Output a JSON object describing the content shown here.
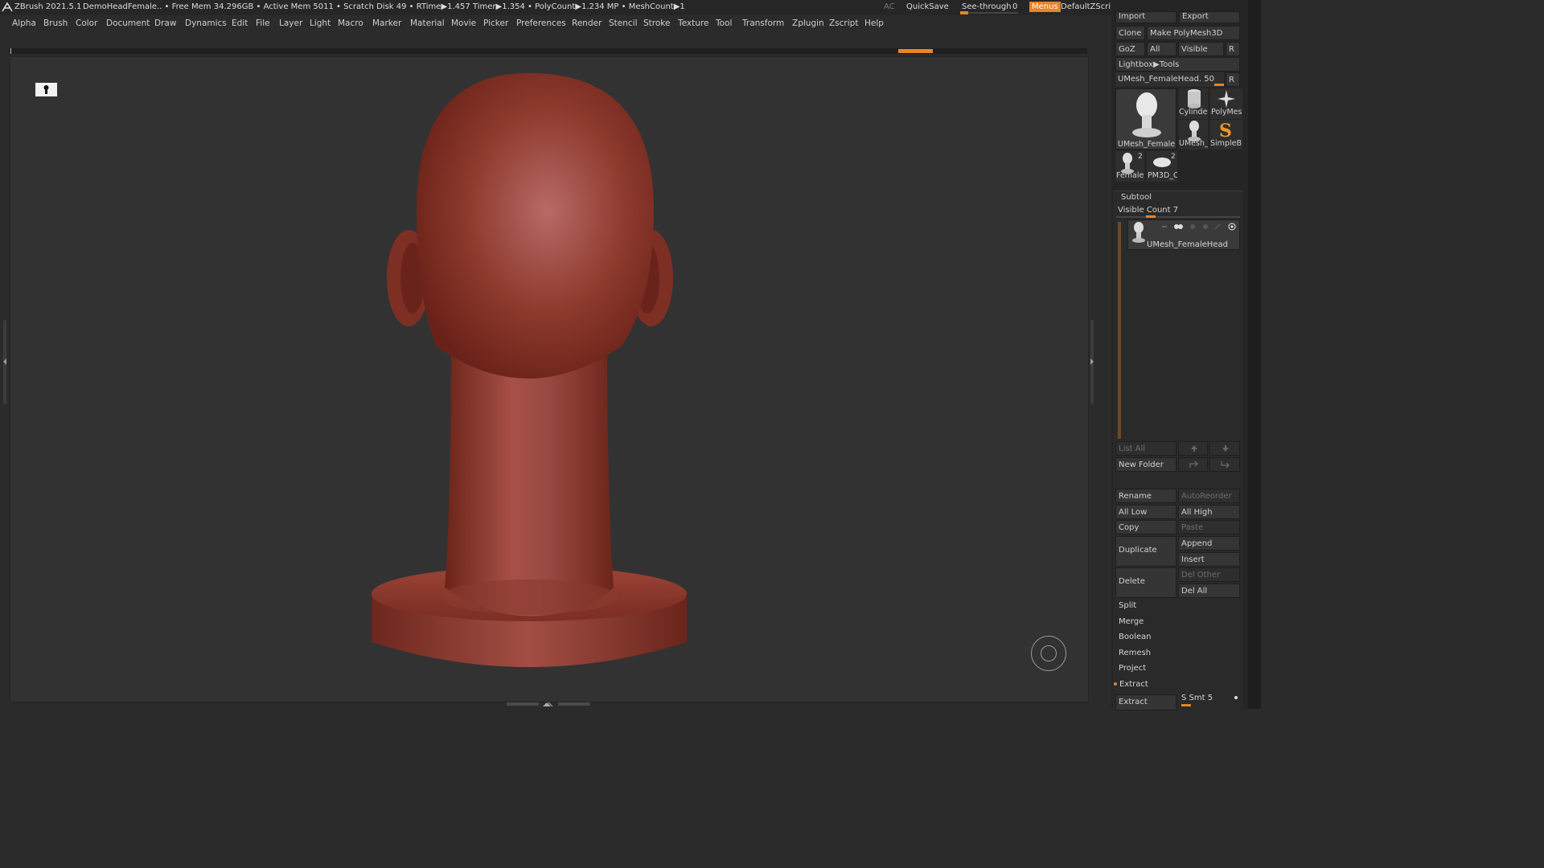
{
  "titlebar": {
    "app": "ZBrush 2021.5.1",
    "document": "DemoHeadFemale",
    "stats": ".. • Free Mem 34.296GB • Active Mem 5011 • Scratch Disk 49 •  RTime▶1.457 Timer▶1.354 • PolyCount▶1.234 MP  • MeshCount▶1",
    "ac": "AC",
    "quicksave": "QuickSave",
    "see_through_label": "See-through",
    "see_through_value": "0",
    "see_through_level": 0,
    "menus": "Menus",
    "zscript": "DefaultZScript"
  },
  "menubar": [
    "Alpha",
    "Brush",
    "Color",
    "Document",
    "Draw",
    "Dynamics",
    "Edit",
    "File",
    "Layer",
    "Light",
    "Macro",
    "Marker",
    "Material",
    "Movie",
    "Picker",
    "Preferences",
    "Render",
    "Stencil",
    "Stroke",
    "Texture",
    "Tool",
    "Transform",
    "Zplugin",
    "Zscript",
    "Help"
  ],
  "tool_panel": {
    "import": "Import",
    "export": "Export",
    "clone": "Clone",
    "make_polymesh": "Make PolyMesh3D",
    "goz": "GoZ",
    "all": "All",
    "visible": "Visible",
    "r": "R",
    "lightbox_tools": "Lightbox▶Tools",
    "current_tool": "UMesh_FemaleHead. 50",
    "current_tool_r": "R",
    "tools": [
      {
        "label": "UMesh_FemaleH",
        "icon": "female-head-icon"
      },
      {
        "label": "Cylinder",
        "icon": "cylinder-icon"
      },
      {
        "label": "PolyMes",
        "icon": "star-icon"
      },
      {
        "label": "UMesh_",
        "icon": "female-head-icon"
      },
      {
        "label": "SimpleB",
        "icon": "simplebrush-icon"
      },
      {
        "label": "FemaleH",
        "badge": "2",
        "icon": "female-head-icon"
      },
      {
        "label": "PM3D_C",
        "badge": "2",
        "icon": "disc-icon"
      }
    ]
  },
  "subtool": {
    "title": "Subtool",
    "visible_count": "Visible Count 7",
    "item_name": "UMesh_FemaleHead",
    "list_all": "List All",
    "new_folder": "New Folder",
    "rename": "Rename",
    "autoreorder": "AutoReorder",
    "all_low": "All Low",
    "all_high": "All High",
    "copy": "Copy",
    "paste": "Paste",
    "duplicate": "Duplicate",
    "append": "Append",
    "insert": "Insert",
    "delete": "Delete",
    "del_other": "Del Other",
    "del_all": "Del All",
    "split": "Split",
    "merge": "Merge",
    "boolean": "Boolean",
    "remesh": "Remesh",
    "project": "Project",
    "extract": "Extract",
    "extract_btn": "Extract",
    "s_smt": "S Smt 5"
  },
  "colors": {
    "accent": "#e8832a",
    "clay": "#8a3328",
    "viewport": "#323232"
  }
}
